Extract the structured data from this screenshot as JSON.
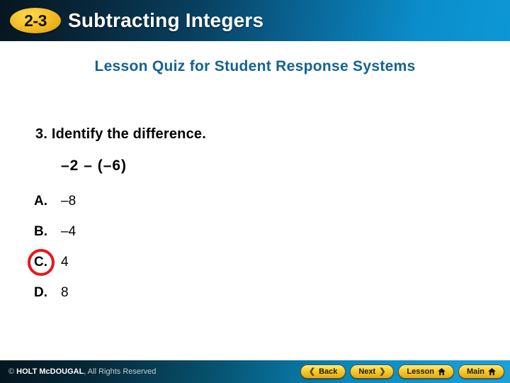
{
  "header": {
    "lesson_number": "2-3",
    "title": "Subtracting Integers",
    "badge_color": "#f5c02a",
    "gradient_start": "#06161f",
    "gradient_end": "#0d97d6"
  },
  "subtitle": {
    "text": "Lesson Quiz for Student Response Systems",
    "color": "#14638f"
  },
  "question": {
    "number": "3.",
    "stem": "3. Identify the difference.",
    "expression": "–2 – (–6)",
    "choices": [
      {
        "letter": "A.",
        "value": "–8",
        "correct": false
      },
      {
        "letter": "B.",
        "value": "–4",
        "correct": false
      },
      {
        "letter": "C.",
        "value": "4",
        "correct": true
      },
      {
        "letter": "D.",
        "value": "8",
        "correct": false
      }
    ],
    "answer_ring_color": "#e8161a"
  },
  "footer": {
    "copyright_symbol": "©",
    "copyright_bold": "HOLT McDOUGAL",
    "copyright_rest": ", All Rights Reserved",
    "buttons": [
      {
        "label": "Back",
        "icon": "chevron-left-icon",
        "icon_glyph": "❮",
        "icon_position": "left",
        "home": false
      },
      {
        "label": "Next",
        "icon": "chevron-right-icon",
        "icon_glyph": "❯",
        "icon_position": "right",
        "home": false
      },
      {
        "label": "Lesson",
        "icon": "home-icon",
        "icon_glyph": "",
        "icon_position": "right",
        "home": true
      },
      {
        "label": "Main",
        "icon": "home-icon",
        "icon_glyph": "",
        "icon_position": "right",
        "home": true
      }
    ],
    "button_color": "#f7ce2e",
    "gradient_start": "#04161f",
    "gradient_end": "#1ba1da"
  }
}
